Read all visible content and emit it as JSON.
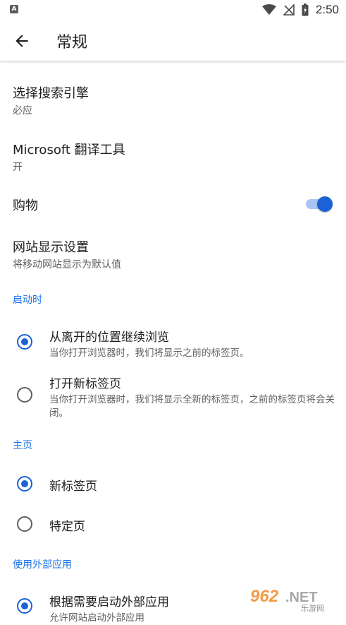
{
  "status_bar": {
    "notification_icon": "a-notification-icon",
    "time": "2:50"
  },
  "app_bar": {
    "title": "常规"
  },
  "settings": [
    {
      "title": "选择搜索引擎",
      "subtitle": "必应"
    },
    {
      "title": "Microsoft 翻译工具",
      "subtitle": "开"
    },
    {
      "title": "购物",
      "toggle": true
    },
    {
      "title": "网站显示设置",
      "subtitle": "将移动网站显示为默认值"
    }
  ],
  "sections": {
    "startup": {
      "header": "启动时",
      "options": [
        {
          "title": "从离开的位置继续浏览",
          "subtitle": "当你打开浏览器时，我们将显示之前的标签页。",
          "selected": true
        },
        {
          "title": "打开新标签页",
          "subtitle": "当你打开浏览器时，我们将显示全新的标签页，之前的标签页将会关闭。",
          "selected": false
        }
      ]
    },
    "home": {
      "header": "主页",
      "options": [
        {
          "title": "新标签页",
          "selected": true
        },
        {
          "title": "特定页",
          "selected": false
        }
      ]
    },
    "external": {
      "header": "使用外部应用",
      "options": [
        {
          "title": "根据需要启动外部应用",
          "subtitle": "允许网站启动外部应用",
          "selected": true
        }
      ]
    }
  },
  "watermark": {
    "text": "962.NET",
    "subtext": "乐游网"
  },
  "colors": {
    "accent": "#1a62d6",
    "section_header": "#1a73e8",
    "toggle_track": "#a9c5f5"
  }
}
